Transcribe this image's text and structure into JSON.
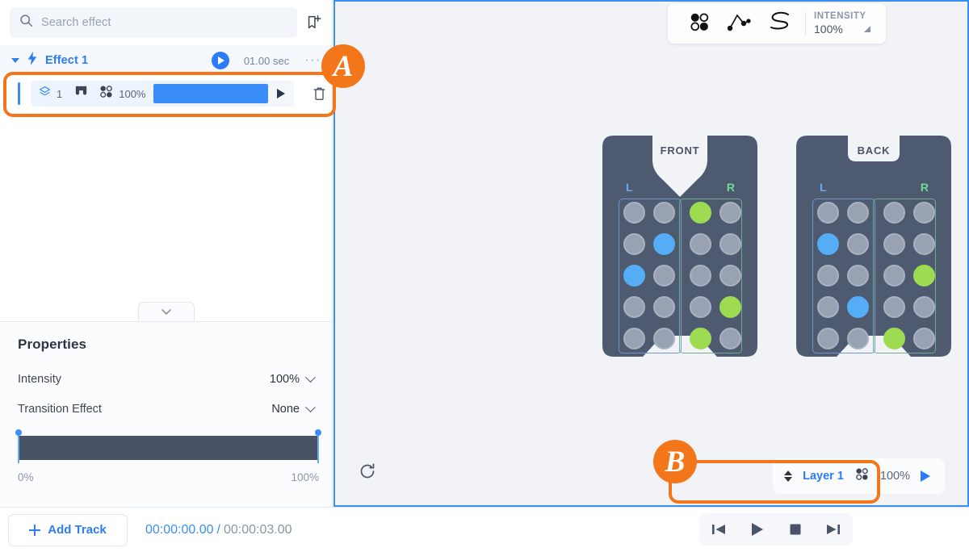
{
  "search": {
    "placeholder": "Search effect",
    "icon": "search-icon",
    "bookmark_icon": "bookmark-add-icon"
  },
  "effect_group": {
    "title": "Effect 1",
    "duration": "01.00 sec",
    "more": "···",
    "lightning_icon": "lightning-bolt-icon",
    "play_icon": "play-icon",
    "caret_icon": "caret-down-icon"
  },
  "track": {
    "layer_icon": "layers-icon",
    "layer_number": "1",
    "waveform_icon": "vest-icon",
    "dots_icon": "dot-pattern-icon",
    "intensity": "100%",
    "play_icon": "play-icon",
    "delete_icon": "trash-icon"
  },
  "properties": {
    "tab_icon": "chevron-down-icon",
    "title": "Properties",
    "rows": [
      {
        "label": "Intensity",
        "value": "100%"
      },
      {
        "label": "Transition Effect",
        "value": "None"
      }
    ],
    "scale_min": "0%",
    "scale_max": "100%"
  },
  "toolbar": {
    "tools": [
      {
        "name": "dot-pattern-tool",
        "icon": "dot-pattern-icon"
      },
      {
        "name": "path-tool",
        "icon": "path-node-icon"
      },
      {
        "name": "freehand-tool",
        "icon": "scribble-s-icon"
      }
    ],
    "intensity_label": "INTENSITY",
    "intensity_value": "100%",
    "intensity_caret": "caret-expand-icon"
  },
  "vests": [
    {
      "name": "front",
      "label": "FRONT",
      "left_label": "L",
      "right_label": "R",
      "left_zone": [
        [
          "off",
          "off"
        ],
        [
          "off",
          "blue"
        ],
        [
          "blue",
          "off"
        ],
        [
          "off",
          "off"
        ],
        [
          "off",
          "off"
        ]
      ],
      "right_zone": [
        [
          "green",
          "off"
        ],
        [
          "off",
          "off"
        ],
        [
          "off",
          "off"
        ],
        [
          "off",
          "green"
        ],
        [
          "green",
          "off"
        ]
      ]
    },
    {
      "name": "back",
      "label": "BACK",
      "left_label": "L",
      "right_label": "R",
      "left_zone": [
        [
          "off",
          "off"
        ],
        [
          "blue",
          "off"
        ],
        [
          "off",
          "off"
        ],
        [
          "off",
          "blue"
        ],
        [
          "off",
          "off"
        ]
      ],
      "right_zone": [
        [
          "off",
          "off"
        ],
        [
          "off",
          "off"
        ],
        [
          "off",
          "green"
        ],
        [
          "off",
          "off"
        ],
        [
          "green",
          "off"
        ]
      ]
    }
  ],
  "canvas": {
    "reset_icon": "refresh-icon"
  },
  "layer_card": {
    "updown_icon": "up-down-arrows-icon",
    "name": "Layer 1",
    "dots_icon": "dot-pattern-icon",
    "intensity": "100%",
    "play_icon": "play-icon"
  },
  "bottom": {
    "add_track_label": "Add Track",
    "add_track_icon": "plus-icon",
    "time_current": "00:00:00.00",
    "time_separator": "/",
    "time_total": "00:00:03.00",
    "transport": [
      {
        "name": "skip-to-start-button",
        "icon": "skip-start-icon"
      },
      {
        "name": "play-button",
        "icon": "play-icon"
      },
      {
        "name": "stop-button",
        "icon": "stop-icon"
      },
      {
        "name": "skip-to-end-button",
        "icon": "skip-end-icon"
      }
    ]
  },
  "annotations": [
    {
      "label": "A",
      "target": "track-row"
    },
    {
      "label": "B",
      "target": "layer-card"
    }
  ],
  "colors": {
    "accent_blue": "#3b8ef8",
    "link_blue": "#2b7cf6",
    "node_blue": "#55aef5",
    "node_green": "#9ddb52",
    "node_off": "#98a2b3",
    "vest_body": "#4e5a70",
    "annotation_orange": "#f4761b",
    "slider_fill": "#485366"
  }
}
